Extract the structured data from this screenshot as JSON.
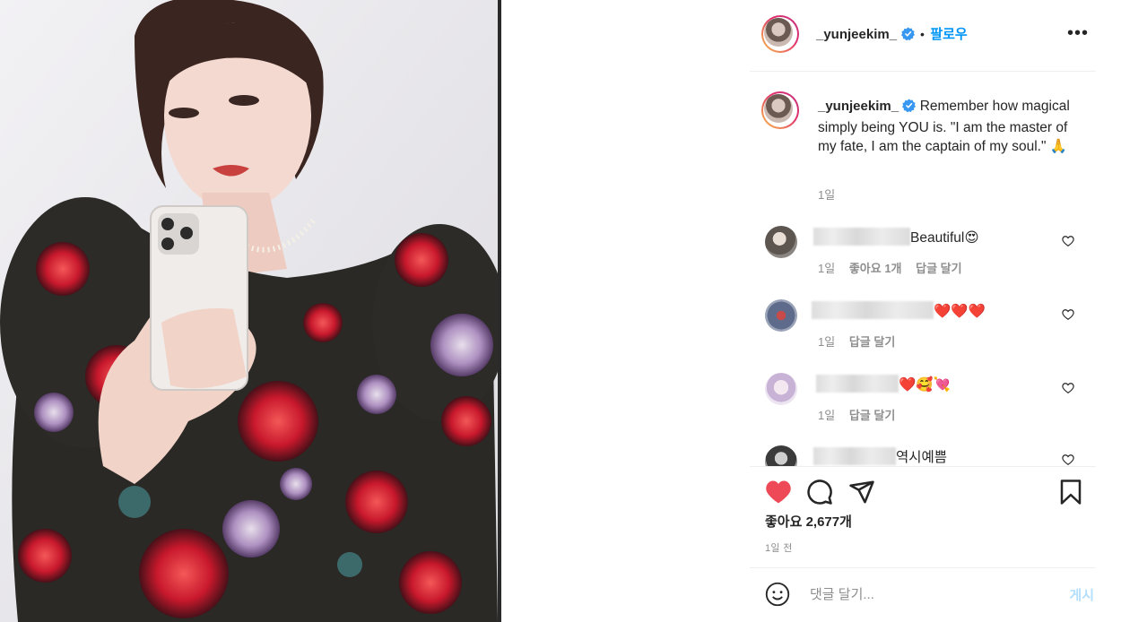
{
  "post": {
    "author": "_yunjeekim_",
    "follow_label": "팔로우",
    "dot": "•",
    "more_label": "•••",
    "caption": "Remember how magical simply being YOU is. \"I am the master of my fate, I am the captain of my soul.\" 🙏",
    "caption_time": "1일"
  },
  "comments": [
    {
      "text": "Beautiful😍",
      "time": "1일",
      "likes": "좋아요 1개",
      "reply": "답글 달기"
    },
    {
      "text": "❤️❤️❤️",
      "time": "1일",
      "reply": "답글 달기"
    },
    {
      "text": "❤️🥰💘",
      "time": "1일",
      "reply": "답글 달기"
    },
    {
      "text": "역시예쁨"
    }
  ],
  "actions": {
    "likes_label": "좋아요 2,677개",
    "posted_time": "1일 전"
  },
  "add_comment": {
    "placeholder": "댓글 달기...",
    "post_label": "게시"
  },
  "icons": {
    "like": "heart-filled-icon",
    "comment": "comment-bubble-icon",
    "share": "paper-plane-icon",
    "save": "bookmark-icon",
    "emoji": "smiley-icon",
    "verified": "verified-badge-icon"
  },
  "colors": {
    "accent": "#0095f6",
    "like_red": "#ed4956",
    "verified_blue": "#3897f0",
    "post_disabled": "#b2dffc"
  }
}
